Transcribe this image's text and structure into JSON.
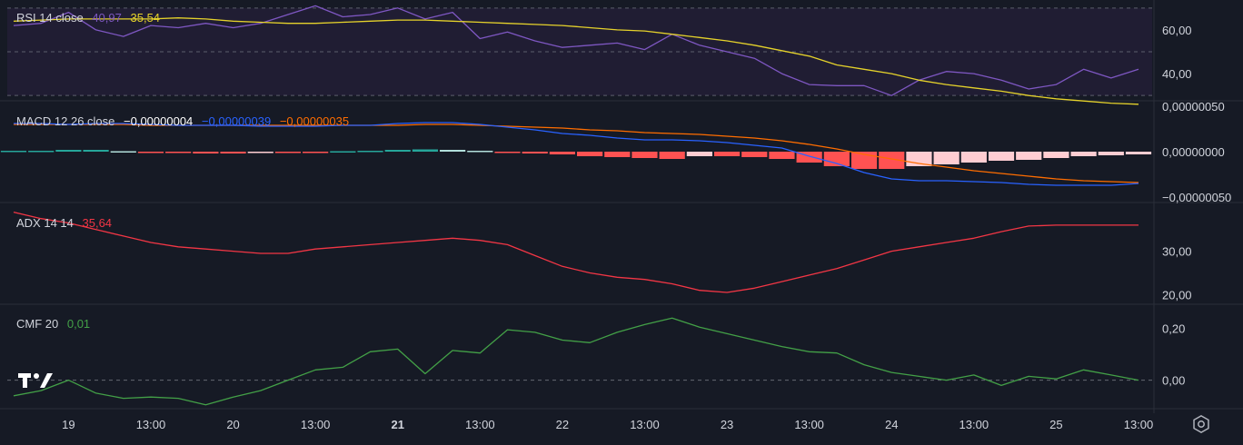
{
  "colors": {
    "background": "#161a25",
    "rsi_band": "#201d33",
    "rsi": "#7e57c2",
    "rsi_ma": "#e5d22b",
    "macd": "#2962ff",
    "signal": "#ff6d00",
    "hist_pos_strong": "#26a69a",
    "hist_pos_weak": "#b2dfdb",
    "hist_neg_strong": "#ff5252",
    "hist_neg_weak": "#ffcdd2",
    "adx": "#f23645",
    "cmf": "#43a047",
    "axis_text": "#d1d4dc",
    "grid": "#2a2e39"
  },
  "panes": {
    "rsi": {
      "title": "RSI 14 close",
      "value1": "40,97",
      "value2": "35,54"
    },
    "macd": {
      "title": "MACD 12 26 close",
      "value1": "−0,00000004",
      "value2": "−0,00000039",
      "value3": "−0,00000035"
    },
    "adx": {
      "title": "ADX 14 14",
      "value1": "35,64"
    },
    "cmf": {
      "title": "CMF 20",
      "value1": "0,01"
    }
  },
  "chart_data": [
    {
      "type": "line",
      "pane": "RSI 14 close",
      "x": [
        0,
        1,
        2,
        3,
        4,
        5,
        6,
        7,
        8,
        9,
        10,
        11,
        12,
        13,
        14,
        15,
        16,
        17,
        18,
        19,
        20,
        21,
        22,
        23,
        24,
        25,
        26,
        27,
        28,
        29,
        30,
        31,
        32,
        33,
        34,
        35,
        36,
        37,
        38,
        39,
        40,
        41
      ],
      "series": [
        {
          "name": "RSI",
          "values": [
            62,
            63,
            68,
            60,
            57,
            62,
            61,
            63,
            61,
            63,
            67,
            71,
            66,
            67,
            70,
            65,
            68,
            56,
            59,
            55,
            52,
            53,
            54,
            51,
            58,
            53,
            50,
            47,
            40,
            35,
            34.5,
            34.5,
            30,
            37,
            41,
            40,
            37,
            33,
            35,
            42,
            38,
            42
          ]
        },
        {
          "name": "MA",
          "values": [
            64,
            64.5,
            65,
            65,
            65,
            65,
            65.5,
            65,
            64,
            63.5,
            63,
            63,
            63.5,
            64,
            64.5,
            64.5,
            64,
            63.5,
            63,
            62.5,
            62,
            61,
            60,
            59.5,
            58,
            56.5,
            55,
            53,
            50.5,
            48,
            44,
            42,
            40,
            37,
            35,
            33.5,
            32,
            30,
            28.5,
            27.5,
            26.5,
            26
          ]
        }
      ],
      "yticks": [
        "60,00",
        "40,00"
      ],
      "bands": [
        30,
        70
      ]
    },
    {
      "type": "line",
      "pane": "MACD 12 26 close",
      "x": [
        0,
        1,
        2,
        3,
        4,
        5,
        6,
        7,
        8,
        9,
        10,
        11,
        12,
        13,
        14,
        15,
        16,
        17,
        18,
        19,
        20,
        21,
        22,
        23,
        24,
        25,
        26,
        27,
        28,
        29,
        30,
        31,
        32,
        33,
        34,
        35,
        36,
        37,
        38,
        39,
        40,
        41
      ],
      "series": [
        {
          "name": "MACD",
          "values": [
            3.1e-07,
            3.1e-07,
            3e-07,
            3.1e-07,
            3.1e-07,
            3e-07,
            2.9e-07,
            2.9e-07,
            2.9e-07,
            2.8e-07,
            2.8e-07,
            2.8e-07,
            2.9e-07,
            2.9e-07,
            3.1e-07,
            3.2e-07,
            3.2e-07,
            3e-07,
            2.7e-07,
            2.4e-07,
            2e-07,
            1.8e-07,
            1.5e-07,
            1.3e-07,
            1.3e-07,
            1.2e-07,
            1e-07,
            7e-08,
            4e-08,
            -5e-08,
            -1.3e-07,
            -2.3e-07,
            -3e-07,
            -3.2e-07,
            -3.2e-07,
            -3.3e-07,
            -3.4e-07,
            -3.6e-07,
            -3.7e-07,
            -3.7e-07,
            -3.7e-07,
            -3.5e-07
          ]
        },
        {
          "name": "Signal",
          "values": [
            3e-07,
            3e-07,
            3e-07,
            3e-07,
            3e-07,
            2.9e-07,
            2.9e-07,
            2.9e-07,
            2.9e-07,
            2.9e-07,
            2.9e-07,
            2.9e-07,
            2.9e-07,
            2.9e-07,
            2.9e-07,
            3e-07,
            3e-07,
            2.9e-07,
            2.8e-07,
            2.7e-07,
            2.6e-07,
            2.4e-07,
            2.3e-07,
            2.1e-07,
            2e-07,
            1.9e-07,
            1.7e-07,
            1.5e-07,
            1.2e-07,
            8e-08,
            3e-08,
            -3e-08,
            -8e-08,
            -1.3e-07,
            -1.7e-07,
            -2.1e-07,
            -2.4e-07,
            -2.7e-07,
            -3e-07,
            -3.2e-07,
            -3.3e-07,
            -3.4e-07
          ]
        },
        {
          "name": "Histogram",
          "values": [
            1e-08,
            1e-08,
            2e-08,
            2e-08,
            5e-09,
            -1e-08,
            -1.5e-08,
            -2e-08,
            -2e-08,
            -1e-08,
            -1e-08,
            -1e-08,
            5e-09,
            1e-08,
            2e-08,
            2.5e-08,
            2e-08,
            1e-08,
            -1e-08,
            -2e-08,
            -3e-08,
            -5e-08,
            -6e-08,
            -7e-08,
            -8e-08,
            -5e-08,
            -5e-08,
            -6e-08,
            -8e-08,
            -1.2e-07,
            -1.6e-07,
            -1.9e-07,
            -1.9e-07,
            -1.6e-07,
            -1.4e-07,
            -1.2e-07,
            -1e-07,
            -9e-08,
            -7e-08,
            -5e-08,
            -4e-08,
            -3e-08
          ]
        }
      ],
      "yticks": [
        "0,00000050",
        "0,00000000",
        "−0,00000050"
      ]
    },
    {
      "type": "line",
      "pane": "ADX 14 14",
      "x": [
        0,
        1,
        2,
        3,
        4,
        5,
        6,
        7,
        8,
        9,
        10,
        11,
        12,
        13,
        14,
        15,
        16,
        17,
        18,
        19,
        20,
        21,
        22,
        23,
        24,
        25,
        26,
        27,
        28,
        29,
        30,
        31,
        32,
        33,
        34,
        35,
        36,
        37,
        38,
        39,
        40,
        41
      ],
      "series": [
        {
          "name": "ADX",
          "values": [
            39,
            37.5,
            36.5,
            35,
            33.5,
            32,
            31,
            30.5,
            30,
            29.5,
            29.5,
            30.5,
            31,
            31.5,
            32,
            32.5,
            33,
            32.5,
            31.5,
            29,
            26.5,
            25,
            24,
            23.5,
            22.5,
            21,
            20.5,
            21.5,
            23,
            24.5,
            26,
            28,
            30,
            31,
            32,
            33,
            34.5,
            35.8,
            36,
            36,
            36,
            36
          ]
        }
      ],
      "yticks": [
        "30,00",
        "20,00"
      ]
    },
    {
      "type": "line",
      "pane": "CMF 20",
      "x": [
        0,
        1,
        2,
        3,
        4,
        5,
        6,
        7,
        8,
        9,
        10,
        11,
        12,
        13,
        14,
        15,
        16,
        17,
        18,
        19,
        20,
        21,
        22,
        23,
        24,
        25,
        26,
        27,
        28,
        29,
        30,
        31,
        32,
        33,
        34,
        35,
        36,
        37,
        38,
        39,
        40,
        41
      ],
      "series": [
        {
          "name": "CMF",
          "values": [
            -0.06,
            -0.04,
            0.0,
            -0.05,
            -0.07,
            -0.065,
            -0.07,
            -0.095,
            -0.065,
            -0.04,
            0.0,
            0.04,
            0.05,
            0.11,
            0.12,
            0.025,
            0.115,
            0.105,
            0.195,
            0.185,
            0.155,
            0.145,
            0.185,
            0.215,
            0.24,
            0.205,
            0.18,
            0.155,
            0.13,
            0.11,
            0.105,
            0.06,
            0.03,
            0.015,
            0.0,
            0.02,
            -0.02,
            0.015,
            0.005,
            0.04,
            0.02,
            0.0
          ]
        }
      ],
      "yticks": [
        "0,20",
        "0,00"
      ]
    }
  ],
  "xaxis": {
    "labels": [
      {
        "text": "19",
        "at": 2,
        "bold": false
      },
      {
        "text": "13:00",
        "at": 5,
        "bold": false
      },
      {
        "text": "20",
        "at": 8,
        "bold": false
      },
      {
        "text": "13:00",
        "at": 11,
        "bold": false
      },
      {
        "text": "21",
        "at": 14,
        "bold": true
      },
      {
        "text": "13:00",
        "at": 17,
        "bold": false
      },
      {
        "text": "22",
        "at": 20,
        "bold": false
      },
      {
        "text": "13:00",
        "at": 23,
        "bold": false
      },
      {
        "text": "23",
        "at": 26,
        "bold": false
      },
      {
        "text": "13:00",
        "at": 29,
        "bold": false
      },
      {
        "text": "24",
        "at": 32,
        "bold": false
      },
      {
        "text": "13:00",
        "at": 35,
        "bold": false
      },
      {
        "text": "25",
        "at": 38,
        "bold": false
      },
      {
        "text": "13:00",
        "at": 41,
        "bold": false
      }
    ]
  },
  "icons": {
    "logo": "tradingview-logo",
    "settings": "gear-icon"
  }
}
